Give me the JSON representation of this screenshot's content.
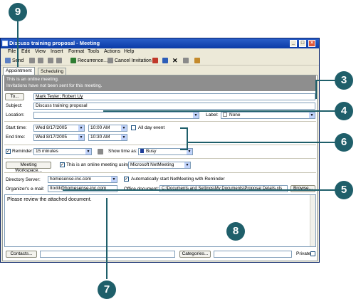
{
  "window": {
    "title": "Discuss training proposal - Meeting"
  },
  "menu": [
    "File",
    "Edit",
    "View",
    "Insert",
    "Format",
    "Tools",
    "Actions",
    "Help"
  ],
  "toolbar": {
    "send": "Send",
    "recurrence": "Recurrence...",
    "cancel_invitation": "Cancel Invitation"
  },
  "tabs": [
    "Appointment",
    "Scheduling"
  ],
  "info": {
    "line1": "This is an online meeting.",
    "line2": "Invitations have not been sent for this meeting."
  },
  "form": {
    "to_button": "To...",
    "to_value": "Mark Teyler; Robert Uy",
    "subject_label": "Subject:",
    "subject_value": "Discuss training proposal",
    "location_label": "Location:",
    "location_value": "",
    "label_label": "Label:",
    "label_value": "None",
    "start_label": "Start time:",
    "start_date": "Wed 8/17/2005",
    "start_time": "10:00 AM",
    "all_day": "All day event",
    "end_label": "End time:",
    "end_date": "Wed 8/17/2005",
    "end_time": "10:30 AM",
    "reminder_label": "Reminder:",
    "reminder_value": "15 minutes",
    "show_time_label": "Show time as:",
    "show_time_value": "Busy",
    "workspace_button": "Meeting Workspace...",
    "online_meeting_label": "This is an online meeting using:",
    "online_meeting_value": "Microsoft NetMeeting",
    "directory_label": "Directory Server:",
    "directory_value": "homesense-inc.com",
    "auto_start_label": "Automatically start NetMeeting with Reminder",
    "organizer_label": "Organizer's e-mail:",
    "organizer_value": "ttodd@homesense-inc.com",
    "office_doc_label": "Office document:",
    "office_doc_value": "C:\\Documents and Settings\\My Documents\\Proposal Details.xls",
    "browse_button": "Browse...",
    "notes": "Please review the attached document.",
    "contacts_button": "Contacts...",
    "categories_button": "Categories...",
    "private_label": "Private"
  },
  "callouts": [
    "9",
    "3",
    "4",
    "6",
    "5",
    "8",
    "7"
  ],
  "colors": {
    "callout": "#1f5f6a",
    "titlebar": "#0a3aa6",
    "info_bar": "#8e8e8e"
  }
}
